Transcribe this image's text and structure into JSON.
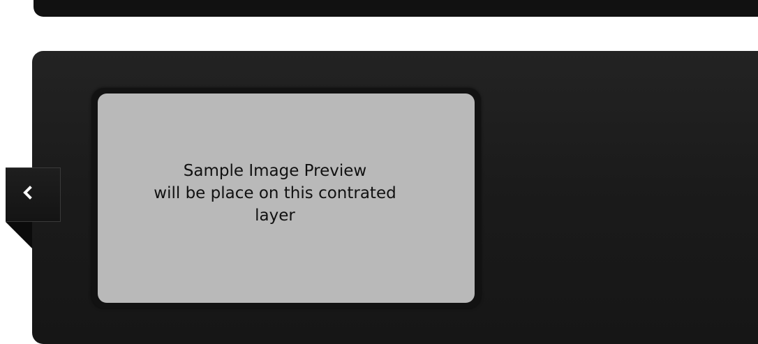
{
  "preview": {
    "text": "Sample Image Preview\nwill be place on this contrated\nlayer"
  },
  "navigation": {
    "prev_icon": "chevron-left-icon"
  },
  "colors": {
    "panel": "#1b1b1b",
    "preview_layer": "#b9b9b9",
    "preview_text": "#111111",
    "icon": "#ffffff"
  }
}
